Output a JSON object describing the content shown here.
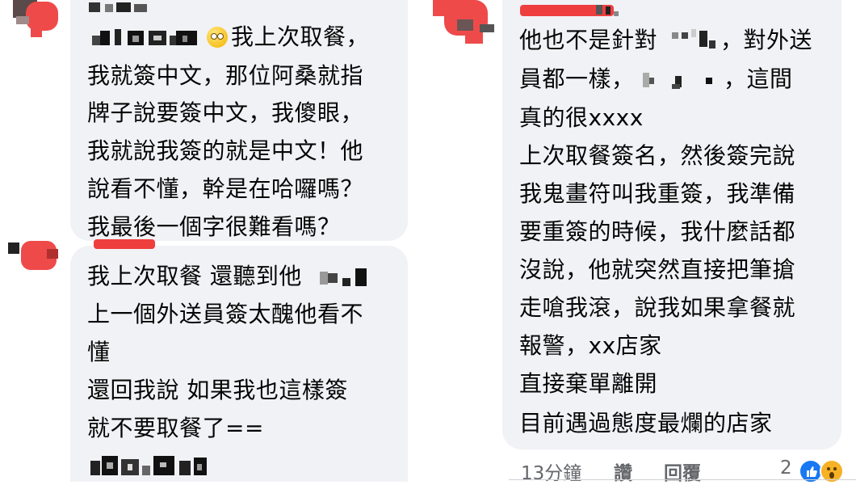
{
  "comment_left_1": {
    "lines": [
      "我上次取餐，",
      "我就簽中文，那位阿桑就指",
      "牌子說要簽中文，我傻眼，",
      "我就說我簽的就是中文！他",
      "說看不懂，幹是在哈囉嗎？",
      "我最後一個字很難看嗎？"
    ]
  },
  "comment_left_2": {
    "lines": [
      "我上次取餐  還聽到他",
      "上一個外送員簽太醜他看不",
      "懂",
      "還回我說  如果我也這樣簽",
      "就不要取餐了=="
    ]
  },
  "comment_right": {
    "lines": [
      "他也不是針對",
      "，對外送",
      "員都一樣，",
      "，這間",
      "真的很xxxx",
      "上次取餐簽名，然後簽完說",
      "我鬼畫符叫我重簽，我準備",
      "要重簽的時候，我什麼話都",
      "沒說，他就突然直接把筆搶",
      "走嗆我滾，說我如果拿餐就",
      "報警，xx店家",
      "直接棄單離開",
      "目前遇過態度最爛的店家"
    ],
    "meta": {
      "time": "13分鐘",
      "like": "讚",
      "reply": "回覆",
      "reaction_count": "2"
    }
  },
  "colors": {
    "bubble": "#f0f2f5",
    "text": "#050505",
    "meta": "#65676b",
    "redaction": "#ef3e3e",
    "like_blue": "#1877f2",
    "wow_yellow": "#f7b125"
  }
}
